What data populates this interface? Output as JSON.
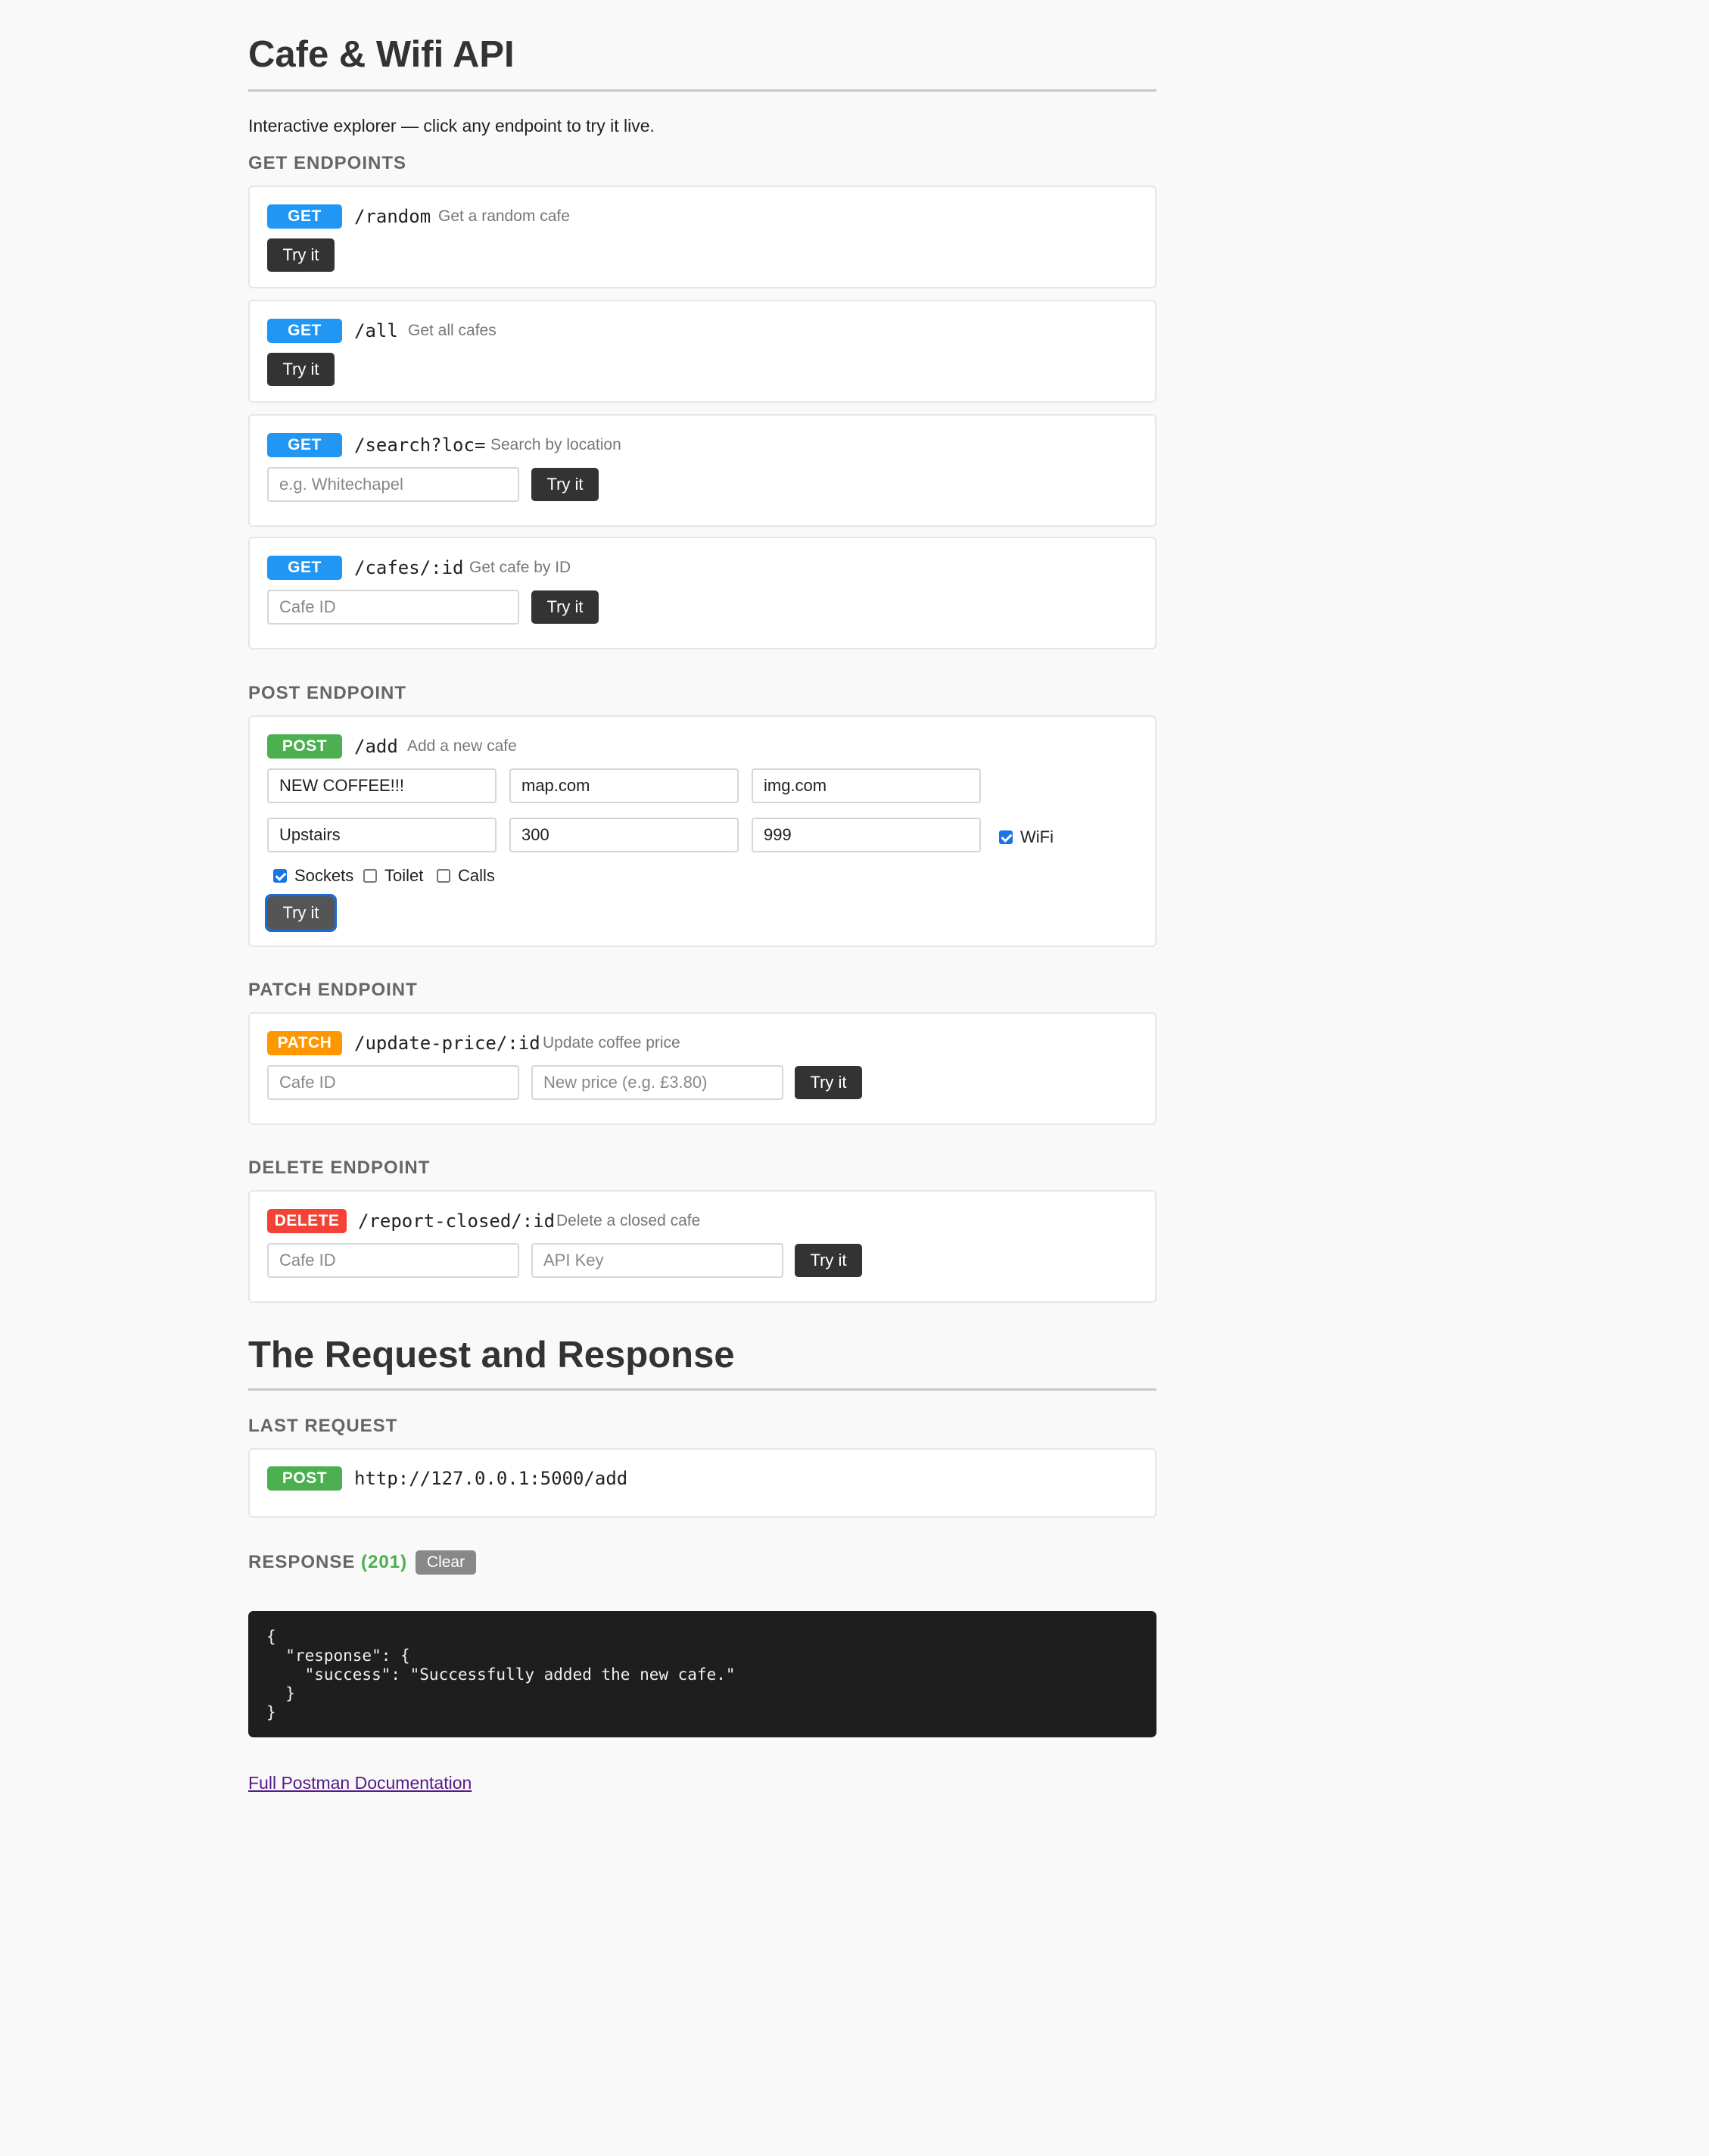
{
  "title": "Cafe & Wifi API",
  "intro": "Interactive explorer — click any endpoint to try it live.",
  "try_label": "Try it",
  "sections": {
    "get": "GET ENDPOINTS",
    "post": "POST ENDPOINT",
    "patch": "PATCH ENDPOINT",
    "delete": "DELETE ENDPOINT"
  },
  "endpoints": {
    "random": {
      "method": "GET",
      "path": "/random",
      "desc": "Get a random cafe"
    },
    "all": {
      "method": "GET",
      "path": "/all",
      "desc": "Get all cafes"
    },
    "search": {
      "method": "GET",
      "path": "/search?loc=",
      "desc": "Search by location",
      "placeholder": "e.g. Whitechapel"
    },
    "cafe": {
      "method": "GET",
      "path": "/cafes/:id",
      "desc": "Get cafe by ID",
      "placeholder": "Cafe ID"
    },
    "add": {
      "method": "POST",
      "path": "/add",
      "desc": "Add a new cafe",
      "fields": {
        "name": "NEW COFFEE!!!",
        "map_url": "map.com",
        "img_url": "img.com",
        "location": "Upstairs",
        "seats": "300",
        "price": "999"
      },
      "checks": {
        "wifi": {
          "label": "WiFi",
          "checked": true
        },
        "sockets": {
          "label": "Sockets",
          "checked": true
        },
        "toilet": {
          "label": "Toilet",
          "checked": false
        },
        "calls": {
          "label": "Calls",
          "checked": false
        }
      }
    },
    "update_price": {
      "method": "PATCH",
      "path": "/update-price/:id",
      "desc": "Update coffee price",
      "placeholder_id": "Cafe ID",
      "placeholder_price": "New price (e.g. £3.80)"
    },
    "report_closed": {
      "method": "DELETE",
      "path": "/report-closed/:id",
      "desc": "Delete a closed cafe",
      "placeholder_id": "Cafe ID",
      "placeholder_key": "API Key"
    }
  },
  "request_response": {
    "title": "The Request and Response",
    "last_request_label": "LAST REQUEST",
    "last_request_method": "POST",
    "last_request_url": "http://127.0.0.1:5000/add",
    "response_label": "RESPONSE",
    "response_status": "(201)",
    "clear_label": "Clear",
    "response_body": "{\n  \"response\": {\n    \"success\": \"Successfully added the new cafe.\"\n  }\n}"
  },
  "doc_link": "Full Postman Documentation",
  "colors": {
    "get": "#2196f3",
    "post": "#4caf50",
    "patch": "#ff9800",
    "delete": "#f44336",
    "status_ok": "#4caf50"
  }
}
